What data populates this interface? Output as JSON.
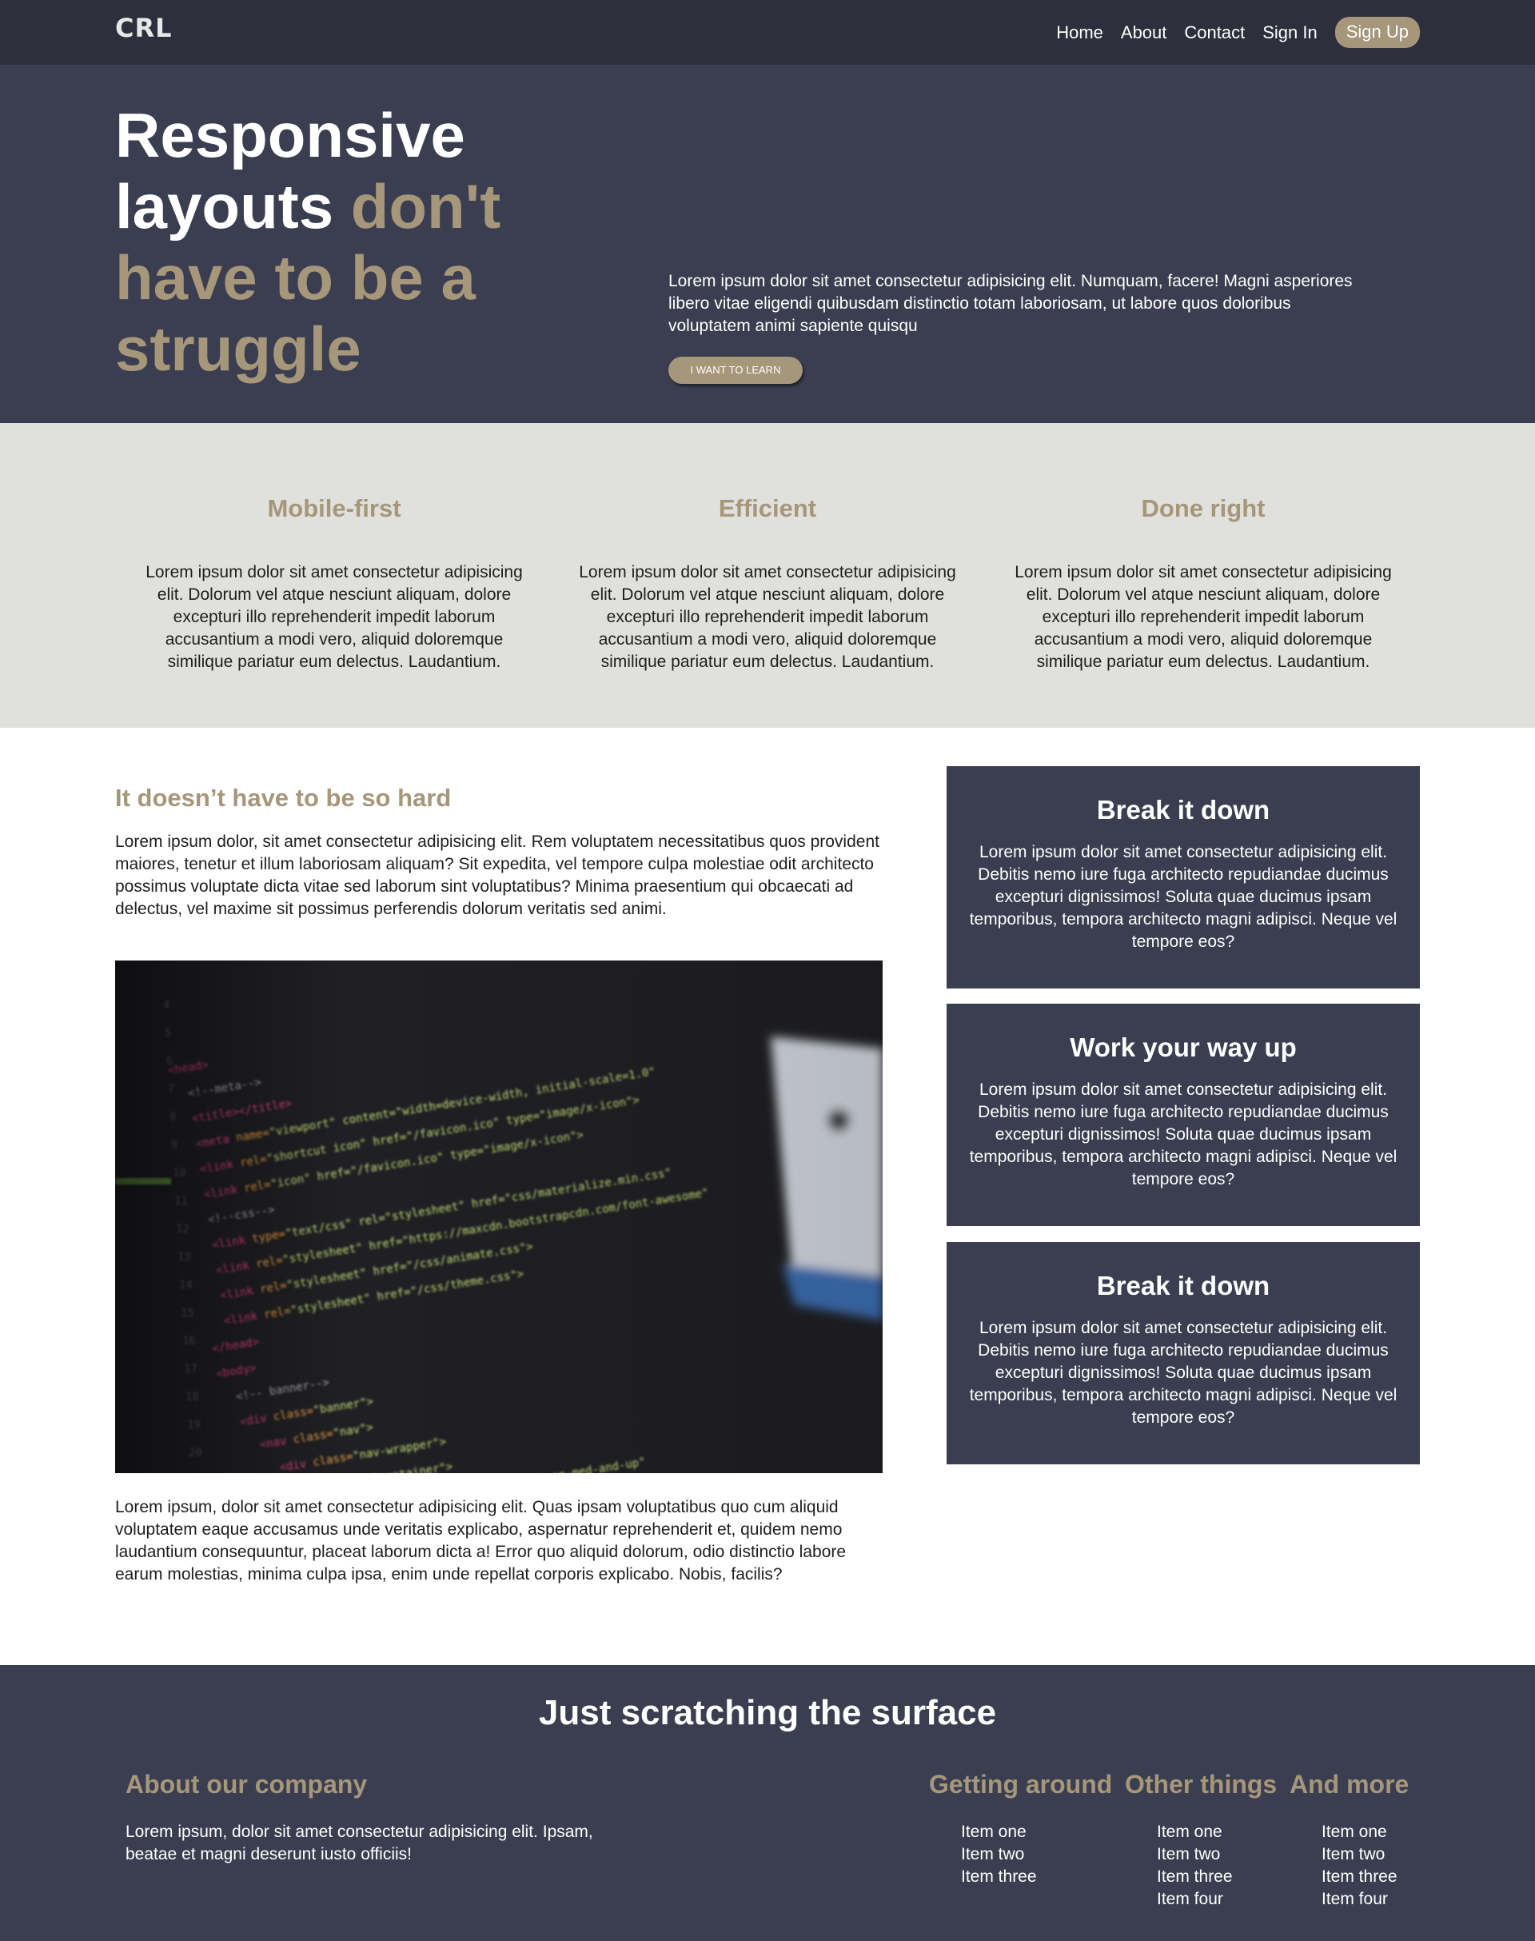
{
  "nav": {
    "logo": "CRL",
    "links": [
      "Home",
      "About",
      "Contact",
      "Sign In"
    ],
    "signup": "Sign Up"
  },
  "hero": {
    "title_plain": "Responsive layouts",
    "title_accent": "don't have to be a struggle",
    "text": "Lorem ipsum dolor sit amet consectetur adipisicing elit. Numquam, facere! Magni asperiores libero vitae eligendi quibusdam distinctio totam laboriosam, ut labore quos doloribus voluptatem animi sapiente quisqu",
    "button": "I want to learn"
  },
  "features": [
    {
      "title": "Mobile-first",
      "text": "Lorem ipsum dolor sit amet consectetur adipisicing elit. Dolorum vel atque nesciunt aliquam, dolore excepturi illo reprehenderit impedit laborum accusantium a modi vero, aliquid doloremque similique pariatur eum delectus. Laudantium."
    },
    {
      "title": "Efficient",
      "text": "Lorem ipsum dolor sit amet consectetur adipisicing elit. Dolorum vel atque nesciunt aliquam, dolore excepturi illo reprehenderit impedit laborum accusantium a modi vero, aliquid doloremque similique pariatur eum delectus. Laudantium."
    },
    {
      "title": "Done right",
      "text": "Lorem ipsum dolor sit amet consectetur adipisicing elit. Dolorum vel atque nesciunt aliquam, dolore excepturi illo reprehenderit impedit laborum accusantium a modi vero, aliquid doloremque similique pariatur eum delectus. Laudantium."
    }
  ],
  "main": {
    "heading": "It doesn’t have to be so hard",
    "para1": "Lorem ipsum dolor, sit amet consectetur adipisicing elit. Rem voluptatem necessitatibus quos provident maiores, tenetur et illum laboriosam aliquam? Sit expedita, vel tempore culpa molestiae odit architecto possimus voluptate dicta vitae sed laborum sint voluptatibus? Minima praesentium qui obcaecati ad delectus, vel maxime sit possimus perferendis dolorum veritatis sed animi.",
    "para2": "Lorem ipsum, dolor sit amet consectetur adipisicing elit. Quas ipsam voluptatibus quo cum aliquid voluptatem eaque accusamus unde veritatis explicabo, aspernatur reprehenderit et, quidem nemo laudantium consequuntur, placeat laborum dicta a! Error quo aliquid dolorum, odio distinctio labore earum molestias, minima culpa ipsa, enim unde repellat corporis explicabo. Nobis, facilis?"
  },
  "cards": [
    {
      "title": "Break it down",
      "text": "Lorem ipsum dolor sit amet consectetur adipisicing elit. Debitis nemo iure fuga architecto repudiandae ducimus excepturi dignissimos! Soluta quae ducimus ipsam temporibus, tempora architecto magni adipisci. Neque vel tempore eos?"
    },
    {
      "title": "Work your way up",
      "text": "Lorem ipsum dolor sit amet consectetur adipisicing elit. Debitis nemo iure fuga architecto repudiandae ducimus excepturi dignissimos! Soluta quae ducimus ipsam temporibus, tempora architecto magni adipisci. Neque vel tempore eos?"
    },
    {
      "title": "Break it down",
      "text": "Lorem ipsum dolor sit amet consectetur adipisicing elit. Debitis nemo iure fuga architecto repudiandae ducimus excepturi dignissimos! Soluta quae ducimus ipsam temporibus, tempora architecto magni adipisci. Neque vel tempore eos?"
    }
  ],
  "footer": {
    "title": "Just scratching the surface",
    "about_heading": "About our company",
    "about_text": "Lorem ipsum, dolor sit amet consectetur adipisicing elit. Ipsam, beatae et magni deserunt iusto officiis!",
    "col1_heading": "Getting around",
    "col1_items": [
      "Item one",
      "Item two",
      "Item three"
    ],
    "col2_heading": "Other things",
    "col2_items": [
      "Item one",
      "Item two",
      "Item three",
      "Item four"
    ],
    "col3_heading": "And more",
    "col3_items": [
      "Item one",
      "Item two",
      "Item three",
      "Item four"
    ]
  },
  "colors": {
    "nav_bg": "#2d303c",
    "hero_bg": "#3b3e50",
    "accent": "#a6967a",
    "features_bg": "#e0e0dc",
    "card_bg": "#3b3e50"
  },
  "image_alt": "code-editor-photo"
}
